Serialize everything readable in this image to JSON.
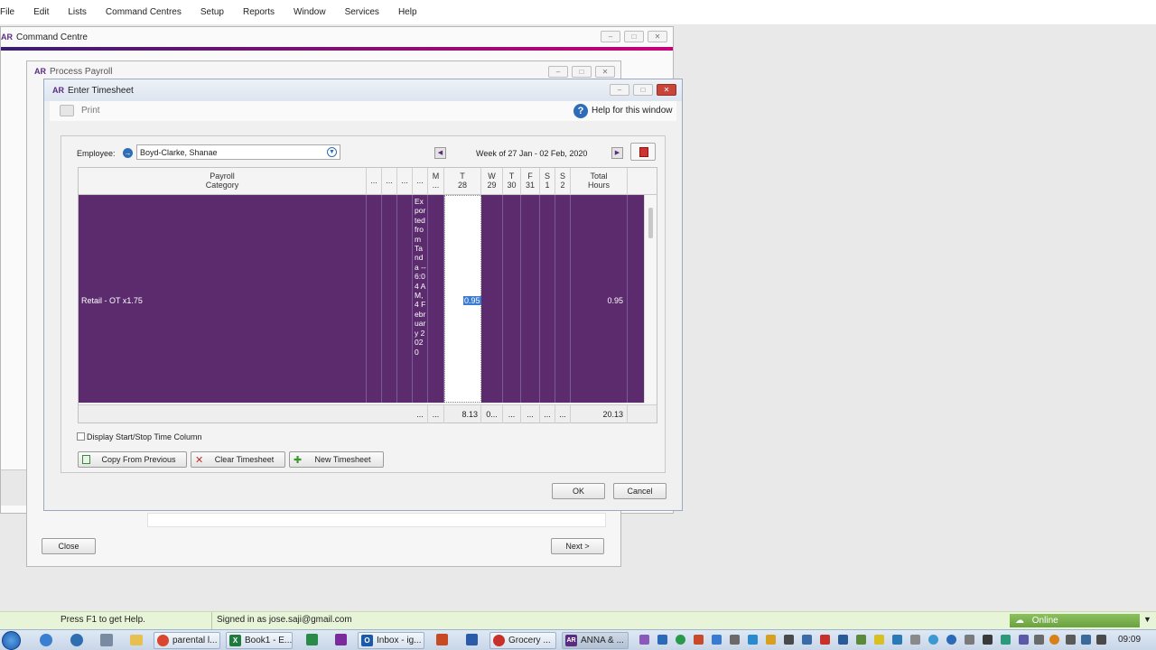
{
  "menu": [
    "File",
    "Edit",
    "Lists",
    "Command Centres",
    "Setup",
    "Reports",
    "Window",
    "Services",
    "Help"
  ],
  "command_centre": {
    "logo": "AR",
    "title": "Command Centre"
  },
  "process_payroll": {
    "logo": "AR",
    "title": "Process Payroll",
    "close_label": "Close",
    "next_label": "Next >"
  },
  "timesheet": {
    "logo": "AR",
    "title": "Enter Timesheet",
    "print_label": "Print",
    "help_label": "Help for this window",
    "employee_label": "Employee:",
    "employee_value": "Boyd-Clarke, Shanae",
    "week_label": "Week of 27 Jan - 02 Feb, 2020",
    "columns": [
      {
        "top": "Payroll",
        "bottom": "Category"
      },
      {
        "top": "...",
        "bottom": ""
      },
      {
        "top": "...",
        "bottom": ""
      },
      {
        "top": "...",
        "bottom": ""
      },
      {
        "top": "...",
        "bottom": ""
      },
      {
        "top": "M",
        "bottom": "..."
      },
      {
        "top": "T",
        "bottom": "28"
      },
      {
        "top": "W",
        "bottom": "29"
      },
      {
        "top": "T",
        "bottom": "30"
      },
      {
        "top": "F",
        "bottom": "31"
      },
      {
        "top": "S",
        "bottom": "1"
      },
      {
        "top": "S",
        "bottom": "2"
      },
      {
        "top": "Total",
        "bottom": "Hours"
      }
    ],
    "row": {
      "category": "Retail - OT x1.75",
      "note": "Exported from Tanda -- 6:04 AM, 4 February 2020",
      "tue_value": "0.95",
      "total": "0.95"
    },
    "footer": {
      "c1": "...",
      "c2": "...",
      "tue": "8.13",
      "wed": "0...",
      "thu": "...",
      "fri": "...",
      "sat": "...",
      "sun": "...",
      "total": "20.13"
    },
    "display_start_stop_label": "Display Start/Stop Time Column",
    "copy_label": "Copy From Previous",
    "clear_label": "Clear Timesheet",
    "new_label": "New Timesheet",
    "ok_label": "OK",
    "cancel_label": "Cancel"
  },
  "status": {
    "help_hint": "Press F1 to get Help.",
    "signed_in": "Signed in as jose.saji@gmail.com",
    "online": "Online"
  },
  "taskbar": {
    "tasks": [
      "parental l...",
      "Book1 - E...",
      "Inbox - ig...",
      "Grocery ...",
      "ANNA & ..."
    ],
    "clock": "09:09"
  },
  "colors": {
    "purple": "#5b2b6e",
    "accent": "#5b2b82",
    "title_stripe": "#c8007a"
  }
}
